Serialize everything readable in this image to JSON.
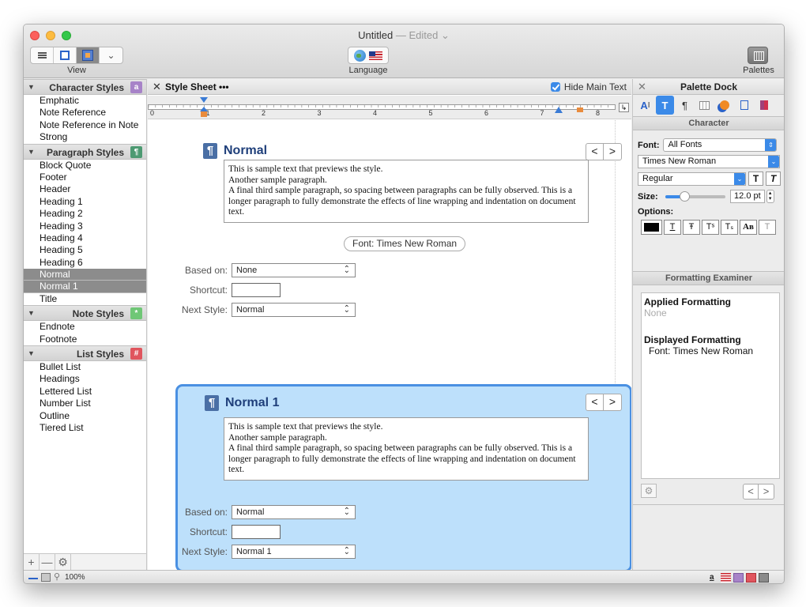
{
  "window": {
    "title": "Untitled",
    "edited": "— Edited ⌄"
  },
  "toolbar": {
    "view_label": "View",
    "language_label": "Language",
    "palettes_label": "Palettes"
  },
  "sidebar": {
    "sections": [
      {
        "title": "Character Styles",
        "badge": "a",
        "badge_color": "#a783c8",
        "items": [
          "Emphatic",
          "Note Reference",
          "Note Reference in Note",
          "Strong"
        ]
      },
      {
        "title": "Paragraph Styles",
        "badge": "¶",
        "badge_color": "#4d9a72",
        "items": [
          "Block Quote",
          "Footer",
          "Header",
          "Heading 1",
          "Heading 2",
          "Heading 3",
          "Heading 4",
          "Heading 5",
          "Heading 6",
          "Normal",
          "Normal 1",
          "Title"
        ]
      },
      {
        "title": "Note Styles",
        "badge": "*",
        "badge_color": "#6fc776",
        "items": [
          "Endnote",
          "Footnote"
        ]
      },
      {
        "title": "List Styles",
        "badge": "#",
        "badge_color": "#e0555e",
        "items": [
          "Bullet List",
          "Headings",
          "Lettered List",
          "Number List",
          "Outline",
          "Tiered List"
        ]
      }
    ],
    "selected": [
      "Normal",
      "Normal 1"
    ],
    "footer": {
      "add": "+",
      "remove": "—",
      "gear": "⚙"
    }
  },
  "stylesheet": {
    "close": "✕",
    "title": "Style Sheet •••",
    "hide_main_text": "Hide Main Text",
    "ruler_numbers": [
      "0",
      "1",
      "2",
      "3",
      "4",
      "5",
      "6",
      "7",
      "8"
    ],
    "ruler_end": "↳",
    "blocks": [
      {
        "name": "Normal",
        "preview_lines": [
          "This is sample text that previews the style.",
          "Another sample paragraph.",
          "A final third sample paragraph, so spacing between paragraphs can be fully observed. This is a longer paragraph to fully demonstrate the effects of line wrapping and indentation on document text."
        ],
        "font_pill": "Font: Times New Roman",
        "based_on_label": "Based on:",
        "based_on": "None",
        "shortcut_label": "Shortcut:",
        "next_style_label": "Next Style:",
        "next_style": "Normal"
      },
      {
        "name": "Normal 1",
        "preview_lines": [
          "This is sample text that previews the style.",
          "Another sample paragraph.",
          "A final third sample paragraph, so spacing between paragraphs can be fully observed. This is a longer paragraph to fully demonstrate the effects of line wrapping and indentation on document text."
        ],
        "based_on_label": "Based on:",
        "based_on": "Normal",
        "shortcut_label": "Shortcut:",
        "next_style_label": "Next Style:",
        "next_style": "Normal 1"
      }
    ],
    "nav_prev": "<",
    "nav_next": ">"
  },
  "palette": {
    "close": "✕",
    "title": "Palette Dock",
    "character_head": "Character",
    "font_label": "Font:",
    "font_collection": "All Fonts",
    "font_family": "Times New Roman",
    "font_style": "Regular",
    "bold_btn": "T",
    "italic_btn": "T",
    "size_label": "Size:",
    "size_value": "12.0 pt",
    "options_label": "Options:",
    "options": [
      "T",
      "Ŧ",
      "Tˢ",
      "Tₛ",
      "Aʙ",
      "T"
    ],
    "examiner_head": "Formatting Examiner",
    "applied_head": "Applied Formatting",
    "applied_value": "None",
    "displayed_head": "Displayed Formatting",
    "displayed_value": "Font: Times New Roman"
  },
  "status": {
    "zoom": "100%"
  },
  "colors": {
    "accent": "#3b8ae8",
    "selected_block": "#bde0fb",
    "selected_border": "#4a90e2",
    "style_heading": "#1f3f7a"
  }
}
